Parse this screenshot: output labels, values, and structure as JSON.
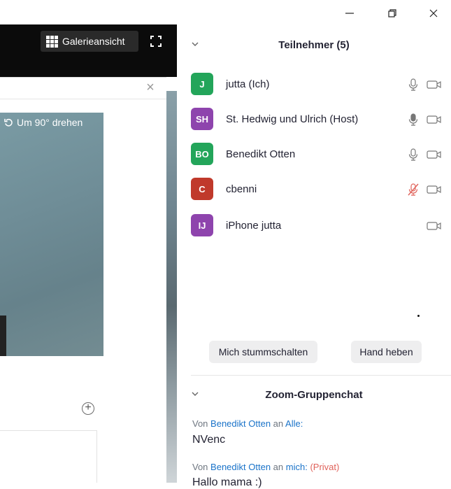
{
  "window": {
    "controls": [
      "minimize-icon",
      "restore-icon",
      "close-icon"
    ]
  },
  "video": {
    "gallery_label": "Galerieansicht",
    "rotate_label": "Um 90° drehen"
  },
  "participants": {
    "title": "Teilnehmer (5)",
    "list": [
      {
        "initials": "J",
        "name": "jutta (Ich)",
        "color": "#23a55a",
        "mic": "on",
        "mic_icon": "microphone-icon",
        "cam": "video-camera-icon"
      },
      {
        "initials": "SH",
        "name": "St. Hedwig und Ulrich (Host)",
        "color": "#8e44ad",
        "mic": "speaking",
        "mic_icon": "microphone-icon",
        "cam": "video-camera-icon"
      },
      {
        "initials": "BO",
        "name": "Benedikt Otten",
        "color": "#23a55a",
        "mic": "on",
        "mic_icon": "microphone-icon",
        "cam": "video-camera-icon"
      },
      {
        "initials": "C",
        "name": "cbenni",
        "color": "#c0392b",
        "mic": "muted",
        "mic_icon": "microphone-muted-icon",
        "cam": "video-camera-icon"
      },
      {
        "initials": "IJ",
        "name": "iPhone jutta",
        "color": "#8e44ad",
        "mic": "none",
        "mic_icon": "",
        "cam": "video-camera-icon"
      }
    ],
    "mute_button": "Mich stummschalten",
    "raise_hand_button": "Hand heben"
  },
  "chat": {
    "title": "Zoom-Gruppenchat",
    "messages": [
      {
        "prefix": "Von",
        "sender": "Benedikt Otten",
        "to_word": "an",
        "recipient": "Alle:",
        "private": "",
        "text": "NVenc"
      },
      {
        "prefix": "Von",
        "sender": "Benedikt Otten",
        "to_word": "an",
        "recipient": "mich:",
        "private": "(Privat)",
        "text": "Hallo mama :)"
      }
    ]
  },
  "colors": {
    "link": "#1a73c9",
    "private": "#e0625a",
    "muted_mic": "#e0625a",
    "text": "#232333"
  }
}
